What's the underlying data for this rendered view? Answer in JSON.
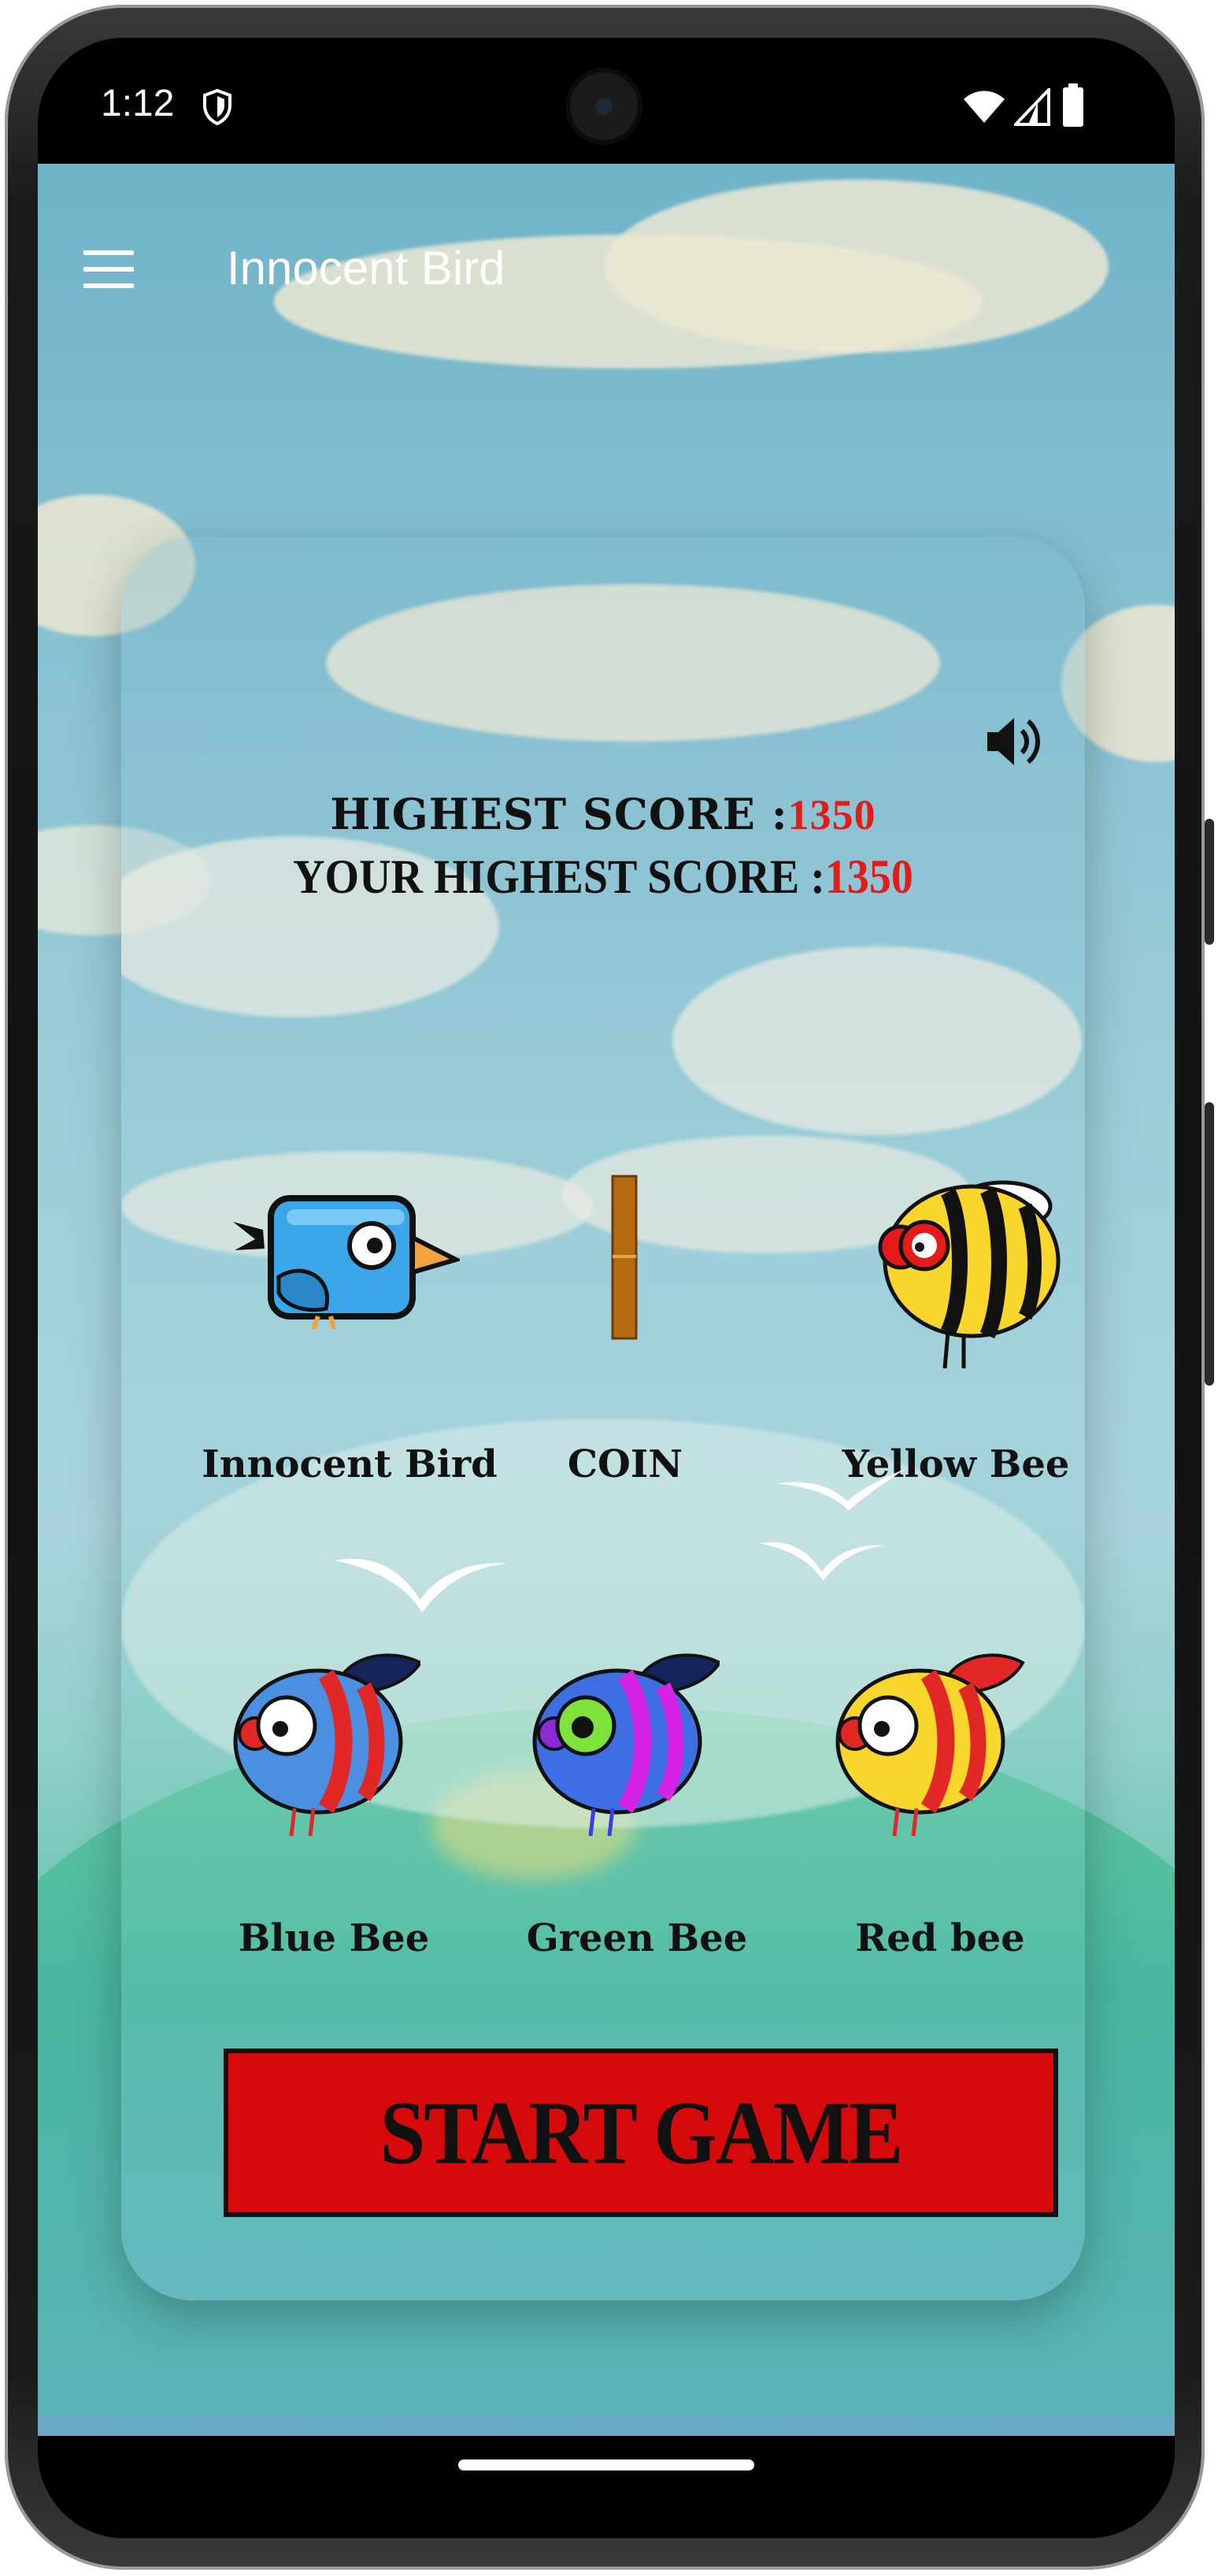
{
  "status_bar": {
    "time": "1:12",
    "icons": [
      "shield-icon",
      "wifi-icon",
      "signal-icon",
      "battery-icon"
    ]
  },
  "toolbar": {
    "title": "Innocent Bird",
    "menu_icon": "hamburger-menu-icon"
  },
  "card": {
    "sound_icon": "volume-icon",
    "highest_score_label": "HIGHEST SCORE :",
    "highest_score_value": "1350",
    "your_highest_score_label": "YOUR HIGHEST SCORE :",
    "your_highest_score_value": "1350",
    "characters": [
      {
        "label": "Innocent Bird",
        "icon": "blue-bird-icon"
      },
      {
        "label": "COIN",
        "icon": "coin-pillar-icon"
      },
      {
        "label": "Yellow Bee",
        "icon": "yellow-bee-icon"
      },
      {
        "label": "Blue Bee",
        "icon": "blue-bee-icon"
      },
      {
        "label": "Green Bee",
        "icon": "green-bee-icon"
      },
      {
        "label": "Red bee",
        "icon": "red-bee-icon"
      }
    ],
    "start_button": "START GAME"
  },
  "colors": {
    "score_value": "#e21b1b",
    "start_button_bg": "#d60a0a",
    "sky": "#8cc4d3",
    "grass": "#5fc2a8"
  }
}
